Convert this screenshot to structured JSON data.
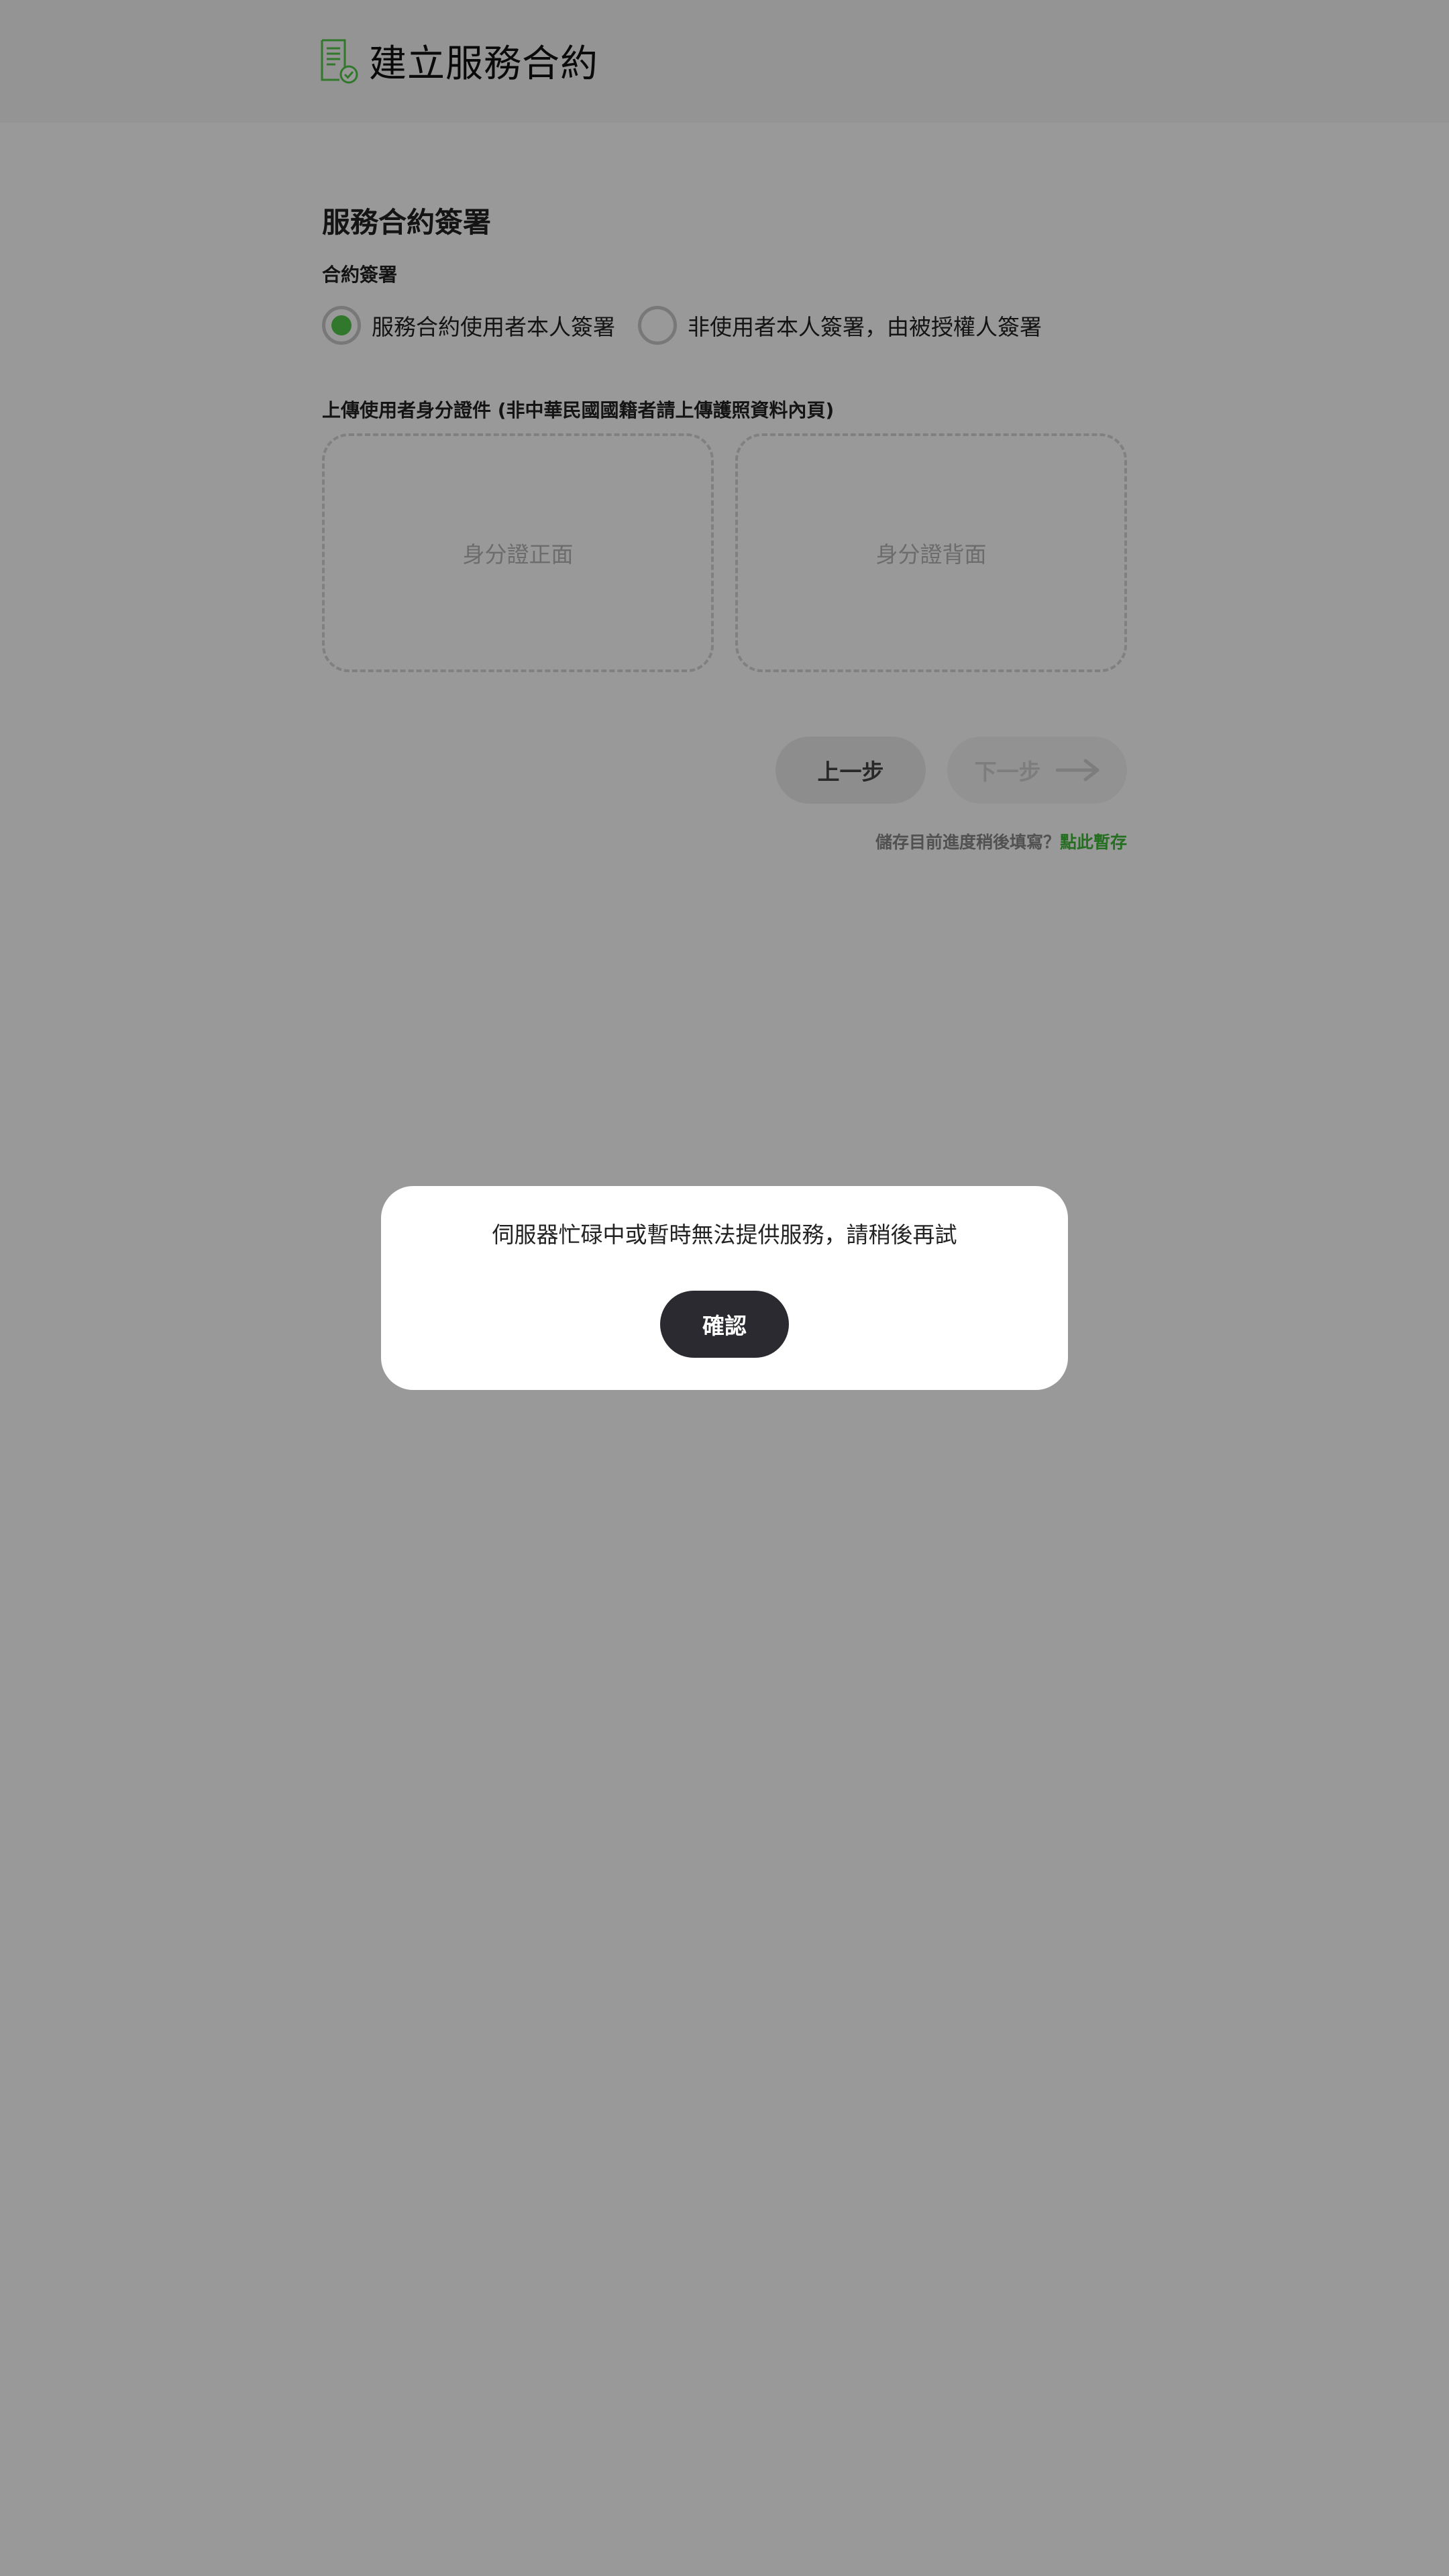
{
  "header": {
    "title": "建立服務合約",
    "icon": "contract-document-icon",
    "accent_color": "#52c74a"
  },
  "form": {
    "section_title": "服務合約簽署",
    "signing_label": "合約簽署",
    "signing_options": [
      {
        "label": "服務合約使用者本人簽署",
        "selected": true
      },
      {
        "label": "非使用者本人簽署，由被授權人簽署",
        "selected": false
      }
    ],
    "upload_label": "上傳使用者身分證件 (非中華民國國籍者請上傳護照資料內頁)",
    "upload_front": "身分證正面",
    "upload_back": "身分證背面",
    "prev_button": "上一步",
    "next_button": "下一步",
    "save_prompt": "儲存目前進度稍後填寫？",
    "save_link": "點此暫存"
  },
  "dialog": {
    "message": "伺服器忙碌中或暫時無法提供服務，請稍後再試",
    "confirm_button": "確認"
  },
  "colors": {
    "overlay": "rgba(0,0,0,0.4)",
    "confirm_button": "#2b2a30",
    "link_green": "#3fb83a"
  }
}
